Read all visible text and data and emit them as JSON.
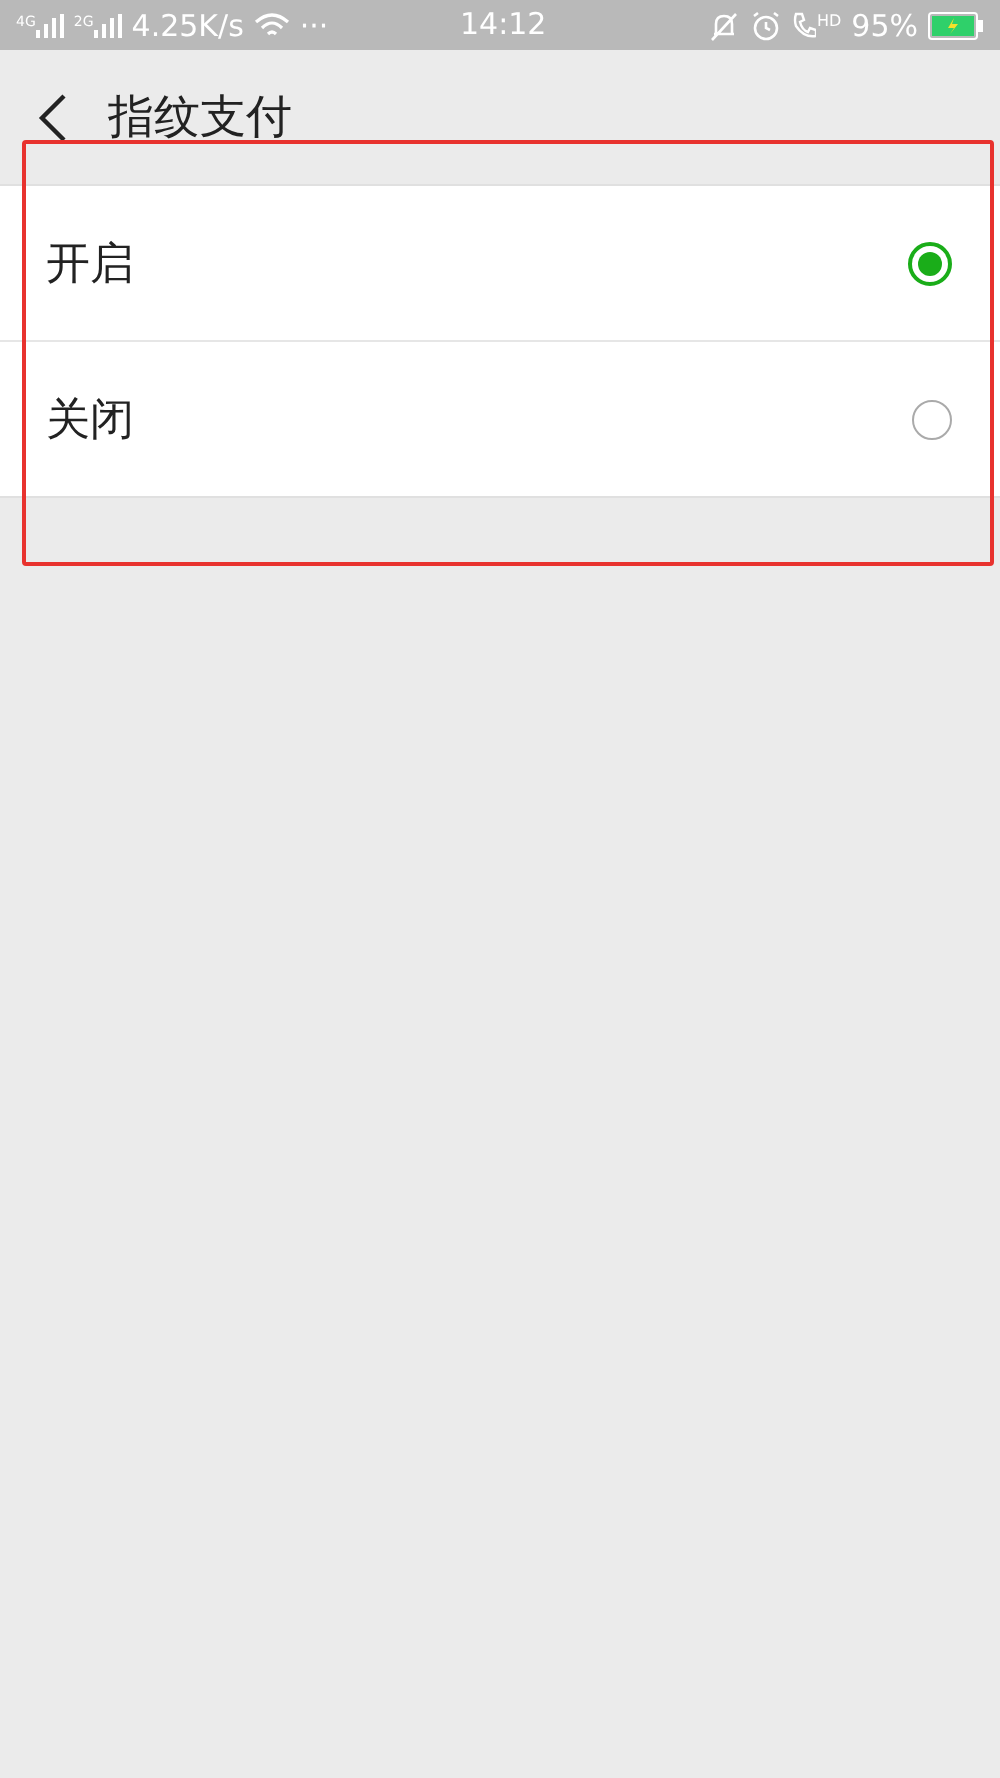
{
  "status_bar": {
    "signals": [
      {
        "label": "4G"
      },
      {
        "label": "2G"
      }
    ],
    "speed": "4.25K/s",
    "more": "···",
    "time": "14:12",
    "call_badge": "HD",
    "battery": "95%",
    "charging": true
  },
  "header": {
    "title": "指纹支付"
  },
  "options": [
    {
      "label": "开启",
      "selected": true
    },
    {
      "label": "关闭",
      "selected": false
    }
  ]
}
